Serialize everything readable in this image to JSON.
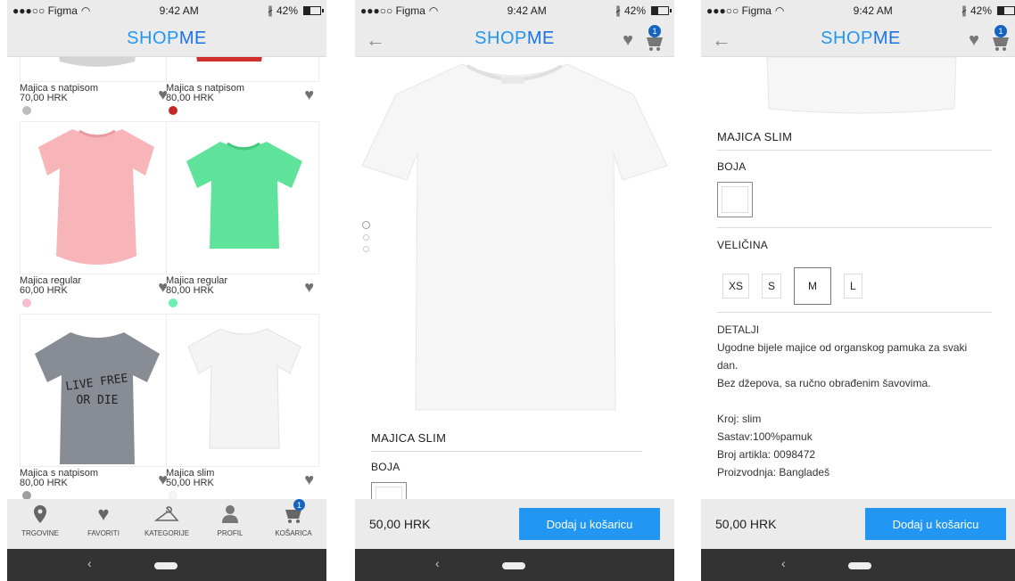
{
  "status": {
    "carrier": "●●●○○ Figma",
    "time": "9:42 AM",
    "battery": "42%"
  },
  "brand": {
    "shop": "SHOP",
    "me": "ME"
  },
  "cart_badge": "1",
  "grid": {
    "items": [
      {
        "name": "Majica s natpisom",
        "price": "70,00 HRK",
        "dot": "#bdbdbd"
      },
      {
        "name": "Majica s natpisom",
        "price": "80,00 HRK",
        "dot": "#c62828"
      },
      {
        "name": "Majica regular",
        "price": "60,00 HRK",
        "dot": "#f8bbd0"
      },
      {
        "name": "Majica regular",
        "price": "80,00 HRK",
        "dot": "#69f0ae"
      },
      {
        "name": "Majica s natpisom",
        "price": "80,00 HRK",
        "dot": "#9e9e9e"
      },
      {
        "name": "Majica slim",
        "price": "50,00 HRK",
        "dot": "#f5f5f5"
      }
    ],
    "shirt_text_1": "LIVE FREE",
    "shirt_text_2": "OR DIE"
  },
  "tabs": [
    {
      "label": "TRGOVINE",
      "icon": "location-pin-icon"
    },
    {
      "label": "FAVORITI",
      "icon": "heart-icon"
    },
    {
      "label": "KATEGORIJE",
      "icon": "hanger-icon"
    },
    {
      "label": "PROFIL",
      "icon": "person-icon"
    },
    {
      "label": "KOŠARICA",
      "icon": "cart-icon"
    }
  ],
  "product": {
    "title": "MAJICA SLIM",
    "color_label": "BOJA",
    "size_label": "VELIČINA",
    "sizes": [
      "XS",
      "S",
      "M",
      "L"
    ],
    "selected_size": "M",
    "details_label": "DETALJI",
    "desc_1": "Ugodne bijele majice od organskog pamuka za svaki",
    "desc_2": "dan.",
    "desc_3": "Bez džepova, sa ručno obrađenim šavovima.",
    "spec_1": "Kroj: slim",
    "spec_2": "Sastav:100%pamuk",
    "spec_3": "Broj artikla: 0098472",
    "spec_4": "Proizvodnja: Bangladeš",
    "price": "50,00 HRK",
    "add_button": "Dodaj u košaricu",
    "colors": {
      "accent": "#2196f3",
      "brand": "#1a73e8"
    }
  }
}
